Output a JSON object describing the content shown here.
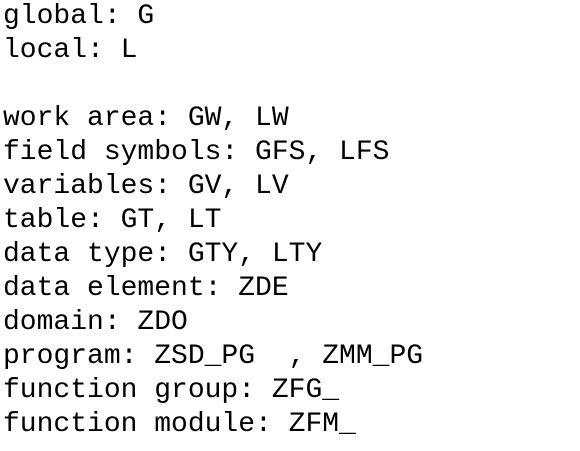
{
  "document": {
    "scope": [
      "global: G",
      "local: L"
    ],
    "naming": [
      "work area: GW, LW",
      "field symbols: GFS, LFS",
      "variables: GV, LV",
      "table: GT, LT",
      "data type: GTY, LTY",
      "data element: ZDE",
      "domain: ZDO",
      "program: ZSD_PG  , ZMM_PG",
      "function group: ZFG_",
      "function module: ZFM_"
    ]
  }
}
